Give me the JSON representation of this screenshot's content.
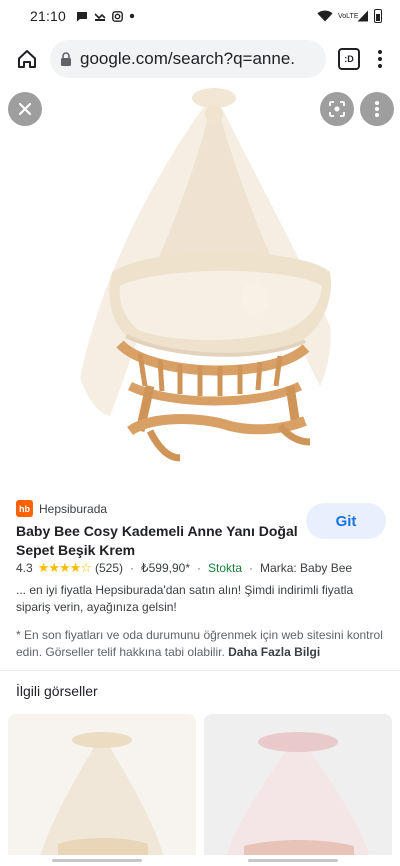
{
  "status_bar": {
    "time": "21:10",
    "notification_icons": [
      "chat-icon",
      "missed-call-icon",
      "instagram-icon",
      "dot-icon"
    ],
    "right_icons": [
      "wifi-icon",
      "volte-icon",
      "signal-icon",
      "battery-icon"
    ],
    "volte_label": "VoLTE"
  },
  "browser": {
    "url": "google.com/search?q=anne.",
    "tab_count": ":D"
  },
  "image": {
    "alt": "Baby Bee Cosy Kademeli Anne Yanı Doğal Sepet Beşik Krem"
  },
  "result": {
    "source": "Hepsiburada",
    "source_logo_text": "hb",
    "title": "Baby Bee Cosy Kademeli Anne Yanı Doğal Sepet Beşik Krem",
    "visit_label": "Git",
    "rating": "4.3",
    "stars": "★★★★☆",
    "rating_count": "(525)",
    "price": "₺599,90*",
    "stock": "Stokta",
    "brand": "Marka: Baby Bee",
    "separator": "·",
    "description": "... en iyi fiyatla Hepsiburada'dan satın alın! Şimdi indirimli fiyatla sipariş verin, ayağınıza gelsin!",
    "note": "* En son fiyatları ve oda durumunu öğrenmek için web sitesini kontrol edin. Görseller telif hakkına tabi olabilir.",
    "more_label": "Daha Fazla Bilgi"
  },
  "related": {
    "title": "İlgili görseller"
  },
  "colors": {
    "accent": "#1a73e8",
    "button_bg": "#e8f0fe",
    "star": "#fbbc04",
    "stock": "#188038",
    "hb_brand": "#ff6000"
  }
}
